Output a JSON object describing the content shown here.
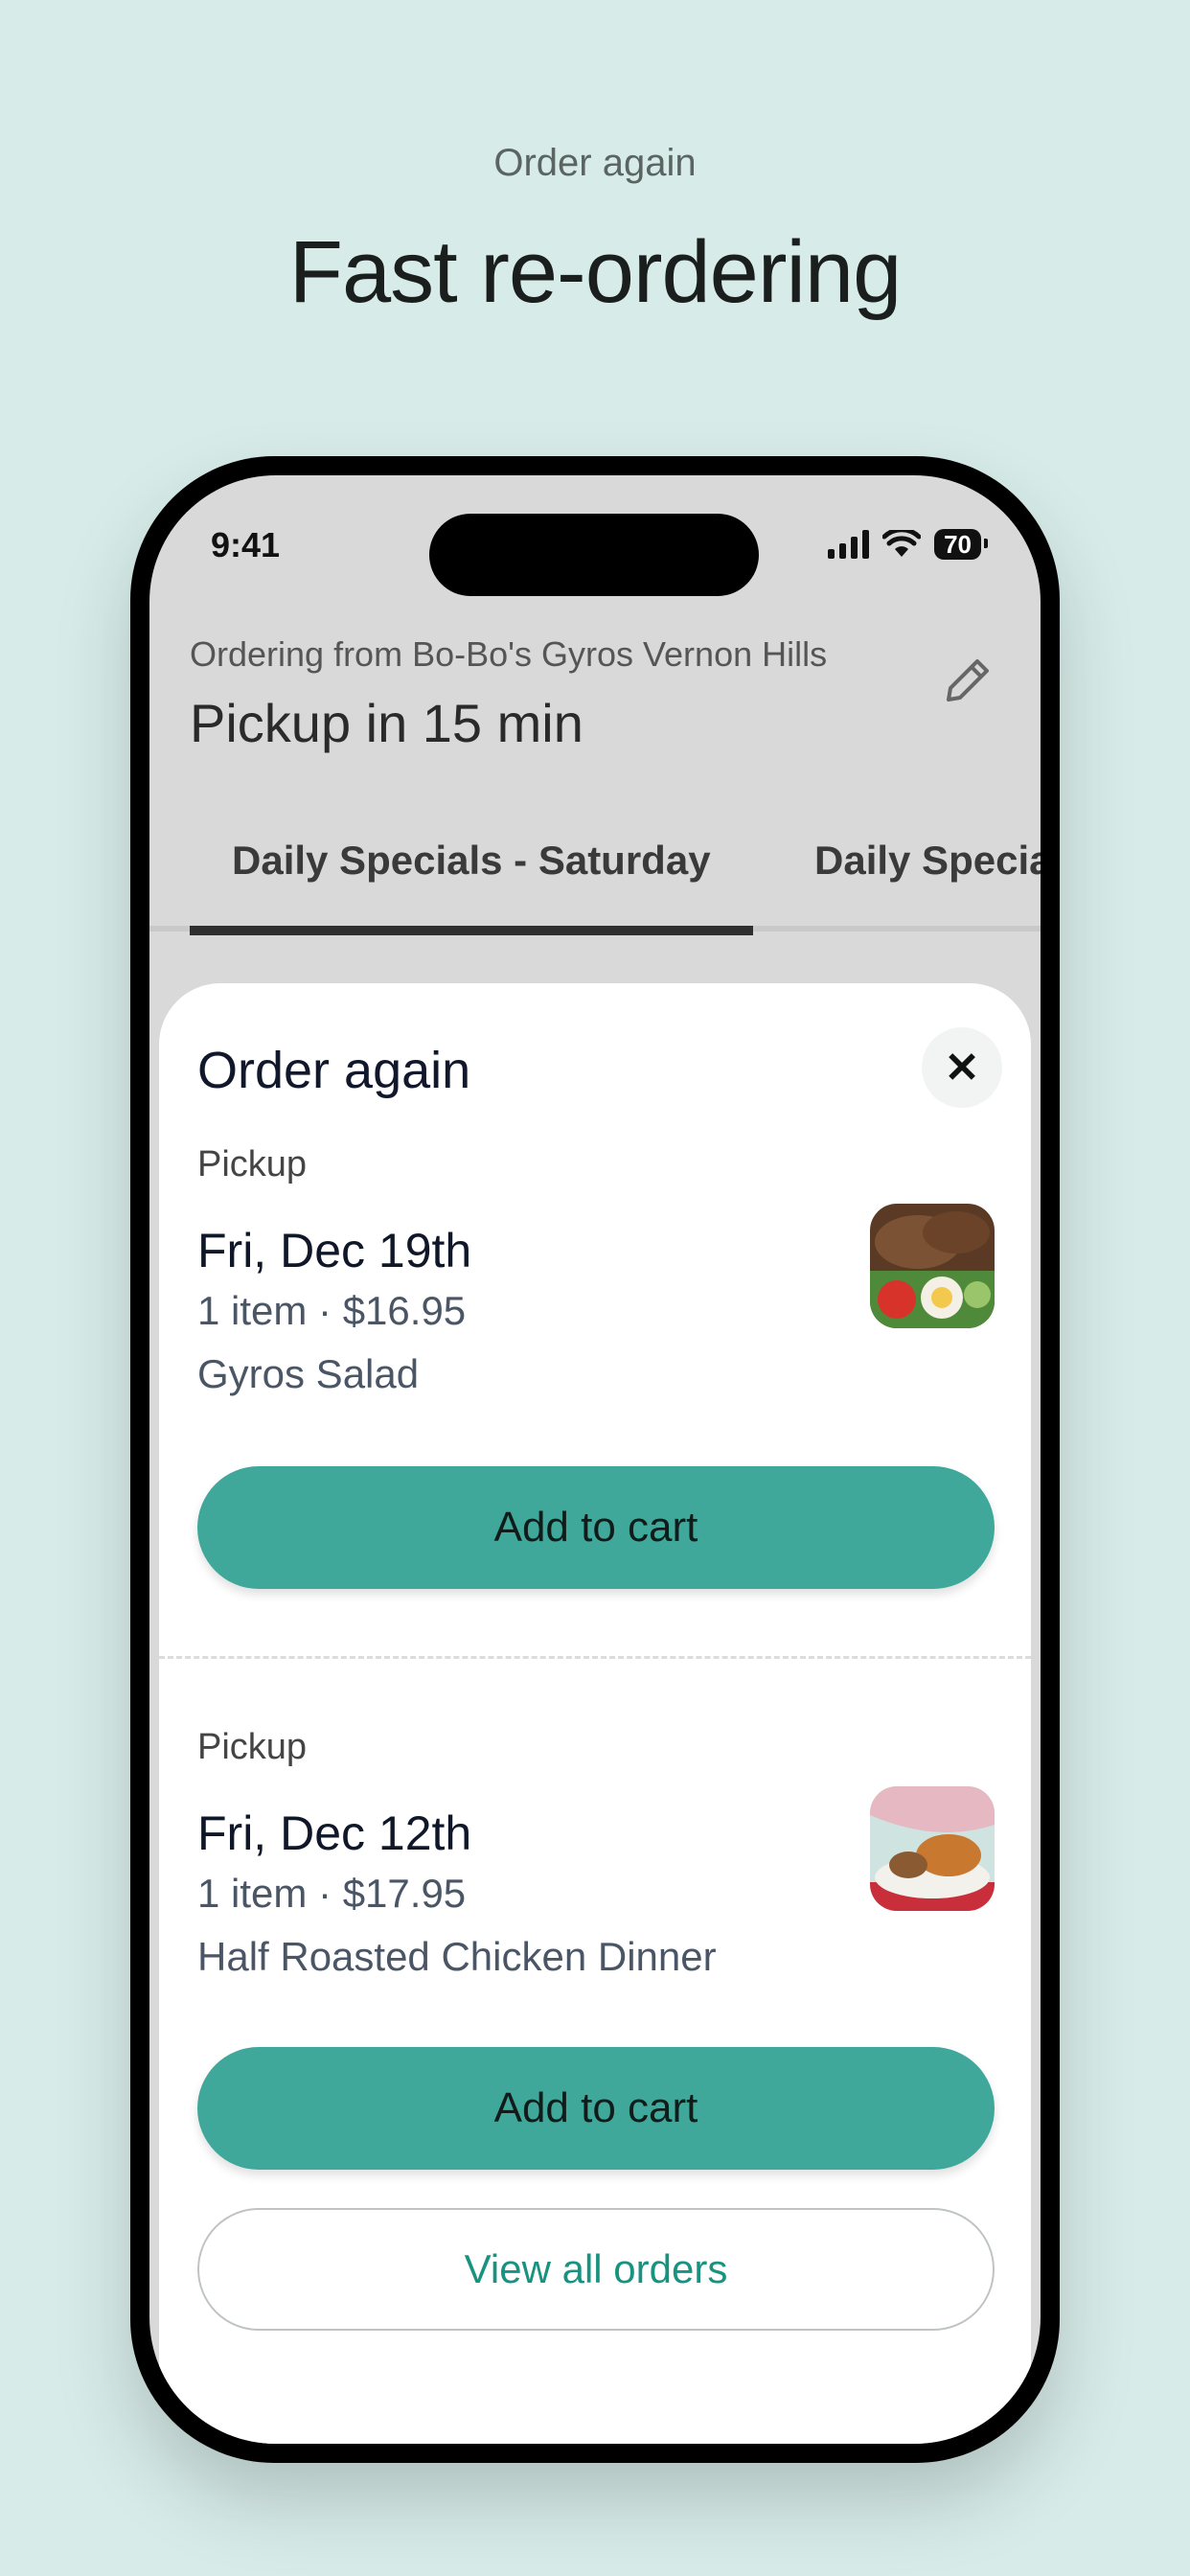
{
  "marketing": {
    "eyebrow": "Order again",
    "headline": "Fast re-ordering"
  },
  "status_bar": {
    "time": "9:41",
    "battery": "70",
    "icons": [
      "signal-icon",
      "wifi-icon",
      "battery-icon"
    ]
  },
  "header": {
    "ordering_from": "Ordering from Bo-Bo's Gyros Vernon Hills",
    "pickup_time": "Pickup in 15 min",
    "edit_icon": "pencil-icon"
  },
  "tabs": [
    {
      "label": "Daily Specials - Saturday",
      "active": true
    },
    {
      "label": "Daily Specia",
      "active": false
    }
  ],
  "sheet": {
    "title": "Order again",
    "close_icon": "close-icon",
    "orders": [
      {
        "method": "Pickup",
        "date": "Fri, Dec 19th",
        "meta": "1 item · $16.95",
        "item": "Gyros Salad",
        "button": "Add to cart"
      },
      {
        "method": "Pickup",
        "date": "Fri, Dec 12th",
        "meta": "1 item · $17.95",
        "item": "Half Roasted Chicken Dinner",
        "button": "Add to cart"
      }
    ],
    "view_all": "View all orders"
  },
  "colors": {
    "background": "#d7ece9",
    "accent": "#40a89b",
    "link": "#199381"
  }
}
